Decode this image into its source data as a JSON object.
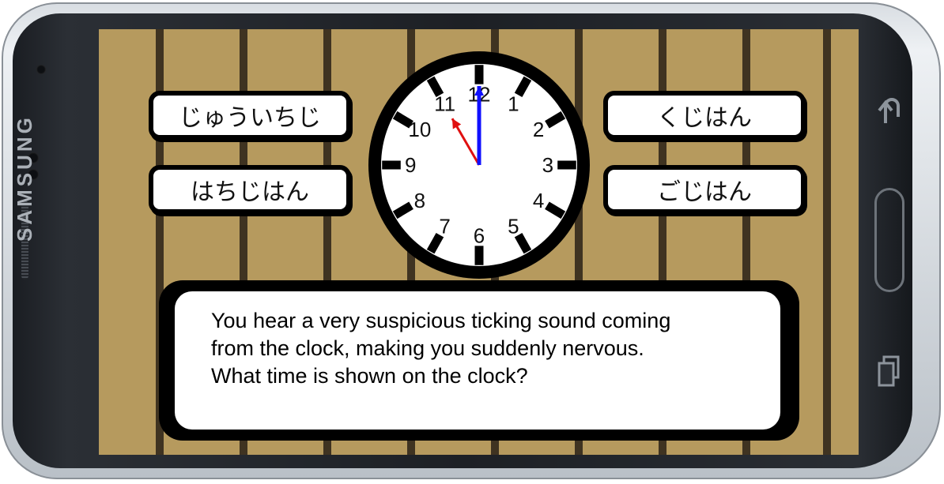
{
  "device": {
    "brand": "SAMSUNG",
    "icons": [
      "back-icon",
      "recent-apps-icon"
    ]
  },
  "answers": [
    {
      "label": "じゅういちじ"
    },
    {
      "label": "くじはん"
    },
    {
      "label": "はちじはん"
    },
    {
      "label": "ごじはん"
    }
  ],
  "clock": {
    "numbers": [
      "12",
      "1",
      "2",
      "3",
      "4",
      "5",
      "6",
      "7",
      "8",
      "9",
      "10",
      "11"
    ],
    "hour": 11,
    "minute": 0,
    "hour_hand_color": "#e01010",
    "minute_hand_color": "#1010ff"
  },
  "dialog": {
    "lines": [
      "You hear a very suspicious ticking sound coming",
      "from the clock, making you suddenly nervous.",
      "What time is shown on the clock?"
    ]
  },
  "colors": {
    "wood": "#b69a5e",
    "plank_line": "#3f3321"
  }
}
